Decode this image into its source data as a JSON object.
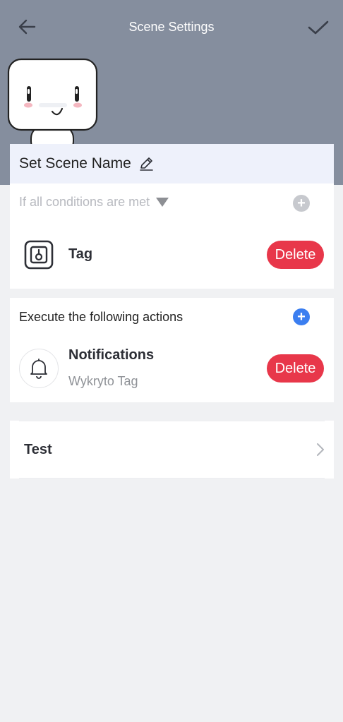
{
  "header": {
    "title": "Scene Settings",
    "back_icon": "arrow-left-icon",
    "confirm_icon": "checkmark-icon",
    "background_color": "#858e9e"
  },
  "scene_name": {
    "label": "Set Scene Name",
    "edit_icon": "pencil-icon"
  },
  "conditions": {
    "selector_label": "If all conditions are met",
    "add_icon": "plus-circle-icon",
    "items": [
      {
        "title": "Tag",
        "icon": "tag-device-icon",
        "delete_label": "Delete"
      }
    ]
  },
  "actions": {
    "header_label": "Execute the following actions",
    "add_icon": "plus-circle-icon",
    "items": [
      {
        "title": "Notifications",
        "subtitle": "Wykryto Tag",
        "icon": "bell-icon",
        "delete_label": "Delete"
      }
    ]
  },
  "test": {
    "label": "Test",
    "chevron_icon": "chevron-right-icon"
  },
  "colors": {
    "delete": "#e8374a",
    "accent_blue": "#3b7ef0",
    "page_background": "#f0f1f3"
  }
}
